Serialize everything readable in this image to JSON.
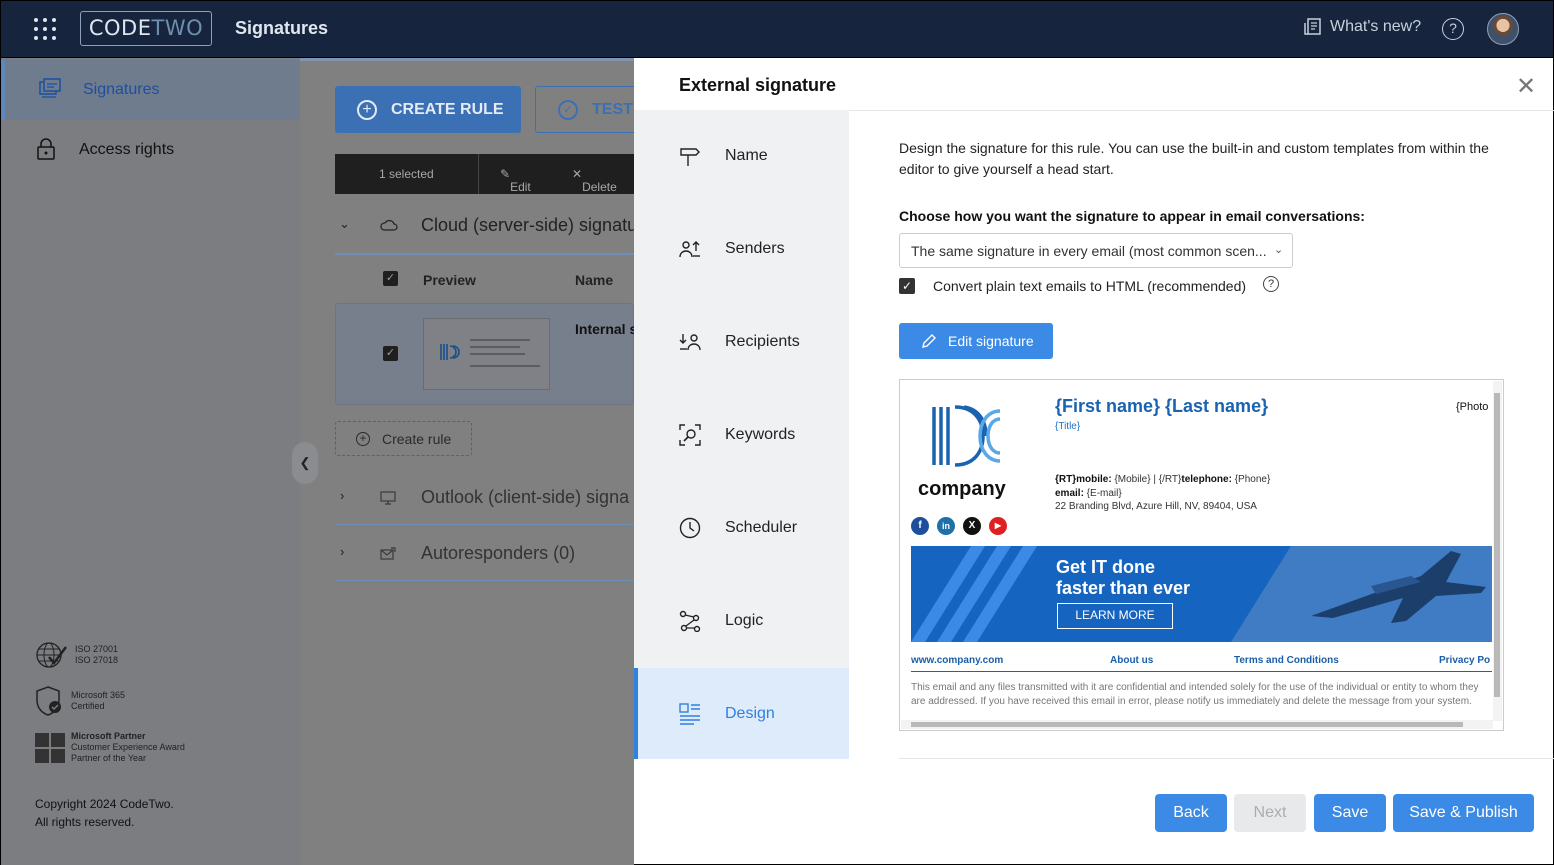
{
  "header": {
    "logo_left": "CODE",
    "logo_right": "TWO",
    "app_title": "Signatures",
    "whats_new": "What's new?",
    "help_symbol": "?"
  },
  "sidebar": {
    "items": [
      {
        "label": "Signatures",
        "icon": "signatures-icon"
      },
      {
        "label": "Access rights",
        "icon": "lock-icon"
      }
    ],
    "certs": [
      {
        "line1": "ISO 27001",
        "line2": "ISO 27018",
        "line3": ""
      },
      {
        "line1": "Microsoft 365",
        "line2": "Certified",
        "line3": ""
      },
      {
        "line1": "Microsoft Partner",
        "line2": "Customer Experience Award",
        "line3": "Partner of the Year"
      }
    ],
    "copyright_line1": "Copyright 2024 CodeTwo.",
    "copyright_line2": "All rights reserved."
  },
  "main": {
    "create_rule": "CREATE RULE",
    "test": "TEST",
    "toolbar": {
      "selected": "1 selected",
      "edit": "Edit",
      "delete": "Delete"
    },
    "groups": [
      {
        "label": "Cloud (server-side) signatu"
      },
      {
        "label": "Outlook (client-side) signa"
      },
      {
        "label": "Autoresponders (0)"
      }
    ],
    "columns": {
      "preview": "Preview",
      "name": "Name"
    },
    "row_name": "Internal s",
    "create_rule_small": "Create rule"
  },
  "panel": {
    "title": "External signature",
    "nav": [
      {
        "label": "Name",
        "icon": "signpost-icon"
      },
      {
        "label": "Senders",
        "icon": "senders-icon"
      },
      {
        "label": "Recipients",
        "icon": "recipients-icon"
      },
      {
        "label": "Keywords",
        "icon": "keywords-icon"
      },
      {
        "label": "Scheduler",
        "icon": "clock-icon"
      },
      {
        "label": "Logic",
        "icon": "logic-icon"
      },
      {
        "label": "Design",
        "icon": "design-icon"
      }
    ],
    "description": "Design the signature for this rule. You can use the built-in and custom templates from within the editor to give yourself a head start.",
    "choose_label": "Choose how you want the signature to appear in email conversations:",
    "select_value": "The same signature in every email (most common scen...",
    "convert_label": "Convert plain text emails to HTML (recommended)",
    "edit_signature": "Edit signature",
    "signature": {
      "name": "{First name} {Last name}",
      "title": "{Title}",
      "photo": "{Photo",
      "company": "company",
      "contact_line1_a": "{RT}mobile:",
      "contact_line1_b": " {Mobile}  |  {/RT}",
      "contact_line1_c": "telephone:",
      "contact_line1_d": " {Phone}",
      "contact_line2_a": "email:",
      "contact_line2_b": " {E-mail}",
      "address": "22 Branding Blvd, Azure Hill, NV, 89404, USA",
      "banner_line1": "Get IT done",
      "banner_line2": "faster than ever",
      "learn_more": "LEARN MORE",
      "links": [
        "www.company.com",
        "About us",
        "Terms and Conditions",
        "Privacy Po"
      ],
      "disclaimer": "This email and any files transmitted with it are confidential and intended solely for the use of the individual or entity to whom they are addressed. If you have received this email in error, please notify us immediately and delete the message from your system."
    },
    "footer": {
      "back": "Back",
      "next": "Next",
      "save": "Save",
      "save_publish": "Save & Publish"
    }
  },
  "colors": {
    "topbar": "#16253d",
    "accent": "#3b8ae6",
    "overlay_blue": "#3b70b5",
    "brand_blue": "#1a63b0"
  }
}
